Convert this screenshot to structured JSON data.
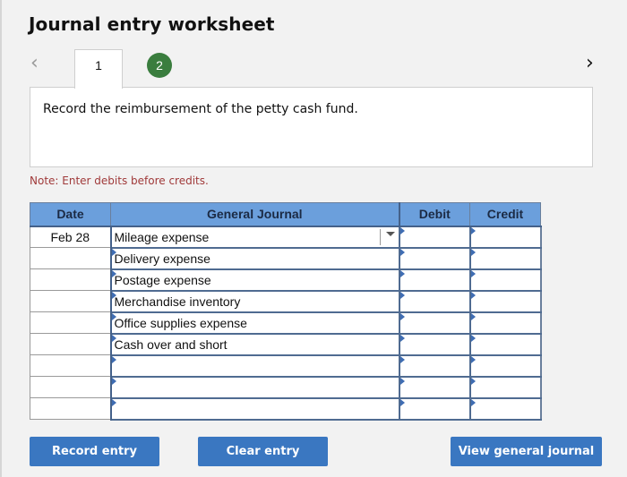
{
  "header": {
    "title": "Journal entry worksheet",
    "prev_icon": "chevron-left-icon",
    "next_icon": "chevron-right-icon"
  },
  "tabs": [
    {
      "label": "1",
      "active": true
    },
    {
      "label": "2",
      "active": false,
      "status": "completed",
      "color": "#3a7d3e"
    }
  ],
  "prompt": {
    "text": "Record the reimbursement of the petty cash fund."
  },
  "note": "Note: Enter debits before credits.",
  "journal": {
    "columns": [
      "Date",
      "General Journal",
      "Debit",
      "Credit"
    ],
    "rows": [
      {
        "date": "Feb 28",
        "account": "Mileage expense",
        "debit": "",
        "credit": "",
        "selected": true
      },
      {
        "date": "",
        "account": "Delivery expense",
        "debit": "",
        "credit": ""
      },
      {
        "date": "",
        "account": "Postage expense",
        "debit": "",
        "credit": ""
      },
      {
        "date": "",
        "account": "Merchandise inventory",
        "debit": "",
        "credit": ""
      },
      {
        "date": "",
        "account": "Office supplies expense",
        "debit": "",
        "credit": ""
      },
      {
        "date": "",
        "account": "Cash over and short",
        "debit": "",
        "credit": ""
      },
      {
        "date": "",
        "account": "",
        "debit": "",
        "credit": ""
      },
      {
        "date": "",
        "account": "",
        "debit": "",
        "credit": ""
      },
      {
        "date": "",
        "account": "",
        "debit": "",
        "credit": ""
      }
    ]
  },
  "buttons": {
    "record": "Record entry",
    "clear": "Clear entry",
    "view": "View general journal"
  },
  "colors": {
    "header_bg": "#6b9fdc",
    "button_bg": "#3a77c1",
    "note_text": "#a03a3a"
  }
}
